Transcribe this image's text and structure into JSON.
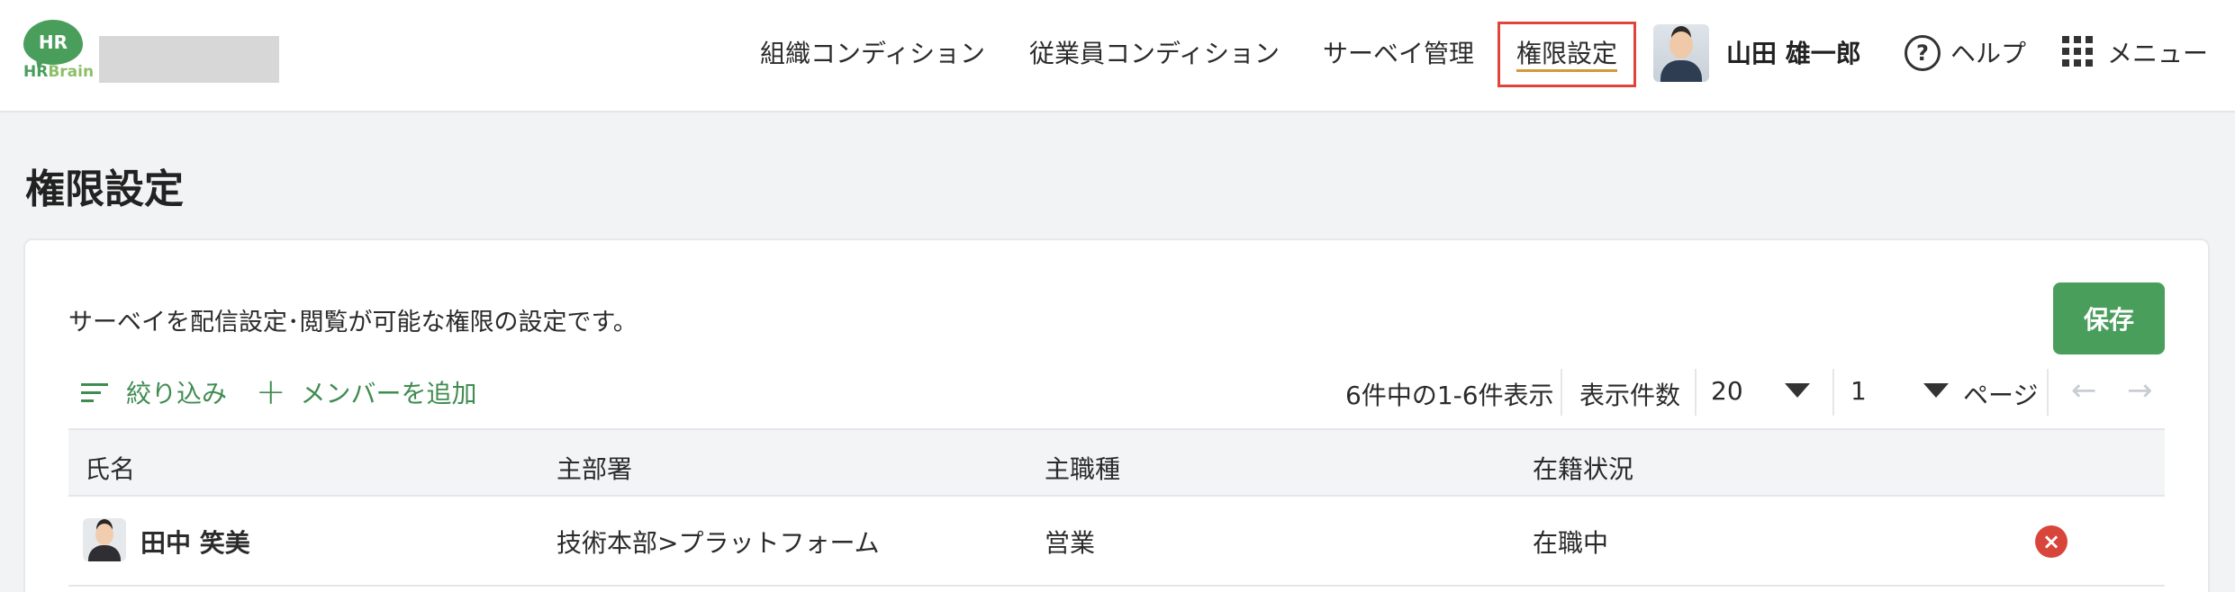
{
  "header": {
    "logo": {
      "bubble_text": "HR",
      "word_dark": "HR",
      "word_light": "Brain"
    },
    "nav": {
      "org_condition": "組織コンディション",
      "employee_condition": "従業員コンディション",
      "survey_admin": "サーベイ管理",
      "permission_settings": "権限設定"
    },
    "user": {
      "name": "山田 雄一郎"
    },
    "help": {
      "icon": "question-circle-icon",
      "label": "ヘルプ"
    },
    "menu": {
      "icon": "grid-icon",
      "label": "メニュー"
    }
  },
  "page": {
    "title": "権限設定",
    "description": "サーベイを配信設定･閲覧が可能な権限の設定です。",
    "save_label": "保存"
  },
  "toolbar": {
    "filter_label": "絞り込み",
    "add_member_label": "メンバーを追加"
  },
  "pagination": {
    "range_text": "6件中の1-6件表示",
    "per_page_label": "表示件数",
    "per_page_value": "20",
    "page_value": "1",
    "page_unit": "ページ",
    "prev_icon": "←",
    "next_icon": "→"
  },
  "table": {
    "columns": [
      "氏名",
      "主部署",
      "主職種",
      "在籍状況"
    ],
    "rows": [
      {
        "name": "田中 笑美",
        "department": "技術本部>プラットフォーム",
        "job_type": "営業",
        "status": "在職中"
      }
    ]
  },
  "colors": {
    "brand_green": "#4a9e5c",
    "active_box": "#e0443a",
    "remove_red": "#d8463b"
  }
}
